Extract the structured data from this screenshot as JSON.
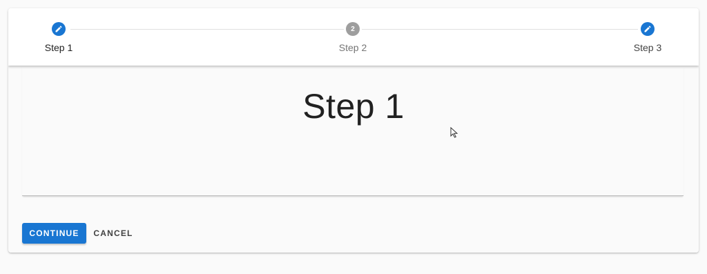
{
  "stepper": {
    "steps": [
      {
        "label": "Step 1",
        "state": "edit",
        "icon": "pencil-icon",
        "avatar_text": ""
      },
      {
        "label": "Step 2",
        "state": "inactive",
        "icon": "",
        "avatar_text": "2"
      },
      {
        "label": "Step 3",
        "state": "edit",
        "icon": "pencil-icon",
        "avatar_text": ""
      }
    ]
  },
  "content": {
    "title": "Step 1"
  },
  "actions": {
    "continue_label": "CONTINUE",
    "cancel_label": "CANCEL"
  },
  "colors": {
    "primary": "#1976d2",
    "inactive": "#9e9e9e",
    "active_text": "#212121",
    "inactive_text": "#757575"
  }
}
